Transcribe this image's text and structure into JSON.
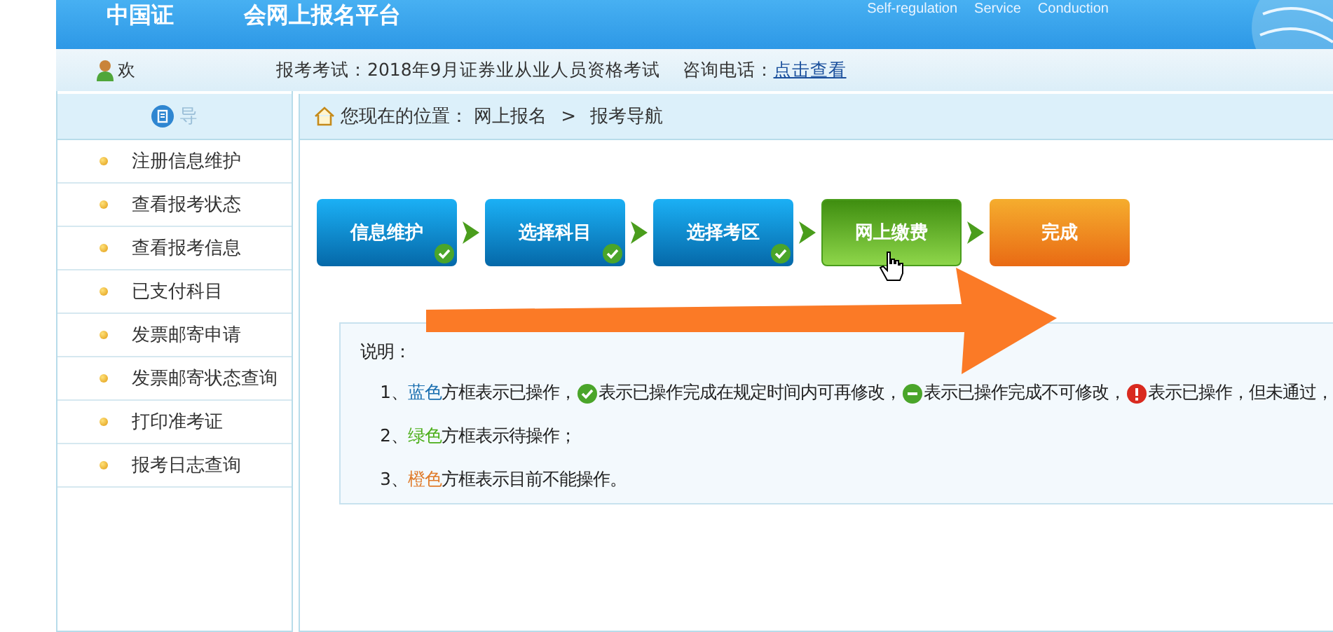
{
  "header": {
    "title_parts": [
      "中国证",
      "会网上报名平台"
    ],
    "links": [
      "Self-regulation",
      "Service",
      "Conduction"
    ]
  },
  "info_bar": {
    "welcome": "欢",
    "exam": "报考考试：2018年9月证券业从业人员资格考试",
    "contact_label": "咨询电话：",
    "contact_link": "点击查看"
  },
  "sidebar": {
    "title": "导",
    "items": [
      {
        "label": "注册信息维护"
      },
      {
        "label": "查看报考状态"
      },
      {
        "label": "查看报考信息"
      },
      {
        "label": "已支付科目"
      },
      {
        "label": "发票邮寄申请"
      },
      {
        "label": "发票邮寄状态查询"
      },
      {
        "label": "打印准考证"
      },
      {
        "label": "报考日志查询"
      }
    ]
  },
  "breadcrumb": {
    "prefix": "您现在的位置：",
    "path": [
      "网上报名",
      "报考导航"
    ],
    "separator": ">"
  },
  "steps": [
    {
      "label": "信息维护",
      "kind": "done"
    },
    {
      "label": "选择科目",
      "kind": "done"
    },
    {
      "label": "选择考区",
      "kind": "done"
    },
    {
      "label": "网上缴费",
      "kind": "pending"
    },
    {
      "label": "完成",
      "kind": "locked"
    }
  ],
  "legend": {
    "title": "说明：",
    "lines": [
      {
        "parts": [
          {
            "kind": "text",
            "text": "1、"
          },
          {
            "kind": "color",
            "text": "蓝色",
            "color": "#1a6fb0"
          },
          {
            "kind": "text",
            "text": "方框表示已操作，"
          },
          {
            "kind": "check"
          },
          {
            "kind": "text",
            "text": "表示已操作完成在规定时间内可再修改，"
          },
          {
            "kind": "minus"
          },
          {
            "kind": "text",
            "text": "表示已操作完成不可修改，"
          },
          {
            "kind": "alert"
          },
          {
            "kind": "text",
            "text": "表示已操作，但未通过，"
          }
        ]
      },
      {
        "parts": [
          {
            "kind": "text",
            "text": "2、"
          },
          {
            "kind": "color",
            "text": "绿色",
            "color": "#4caf1a"
          },
          {
            "kind": "text",
            "text": "方框表示待操作；"
          }
        ]
      },
      {
        "parts": [
          {
            "kind": "text",
            "text": "3、"
          },
          {
            "kind": "color",
            "text": "橙色",
            "color": "#e07b2a"
          },
          {
            "kind": "text",
            "text": "方框表示目前不能操作。"
          }
        ]
      }
    ]
  }
}
